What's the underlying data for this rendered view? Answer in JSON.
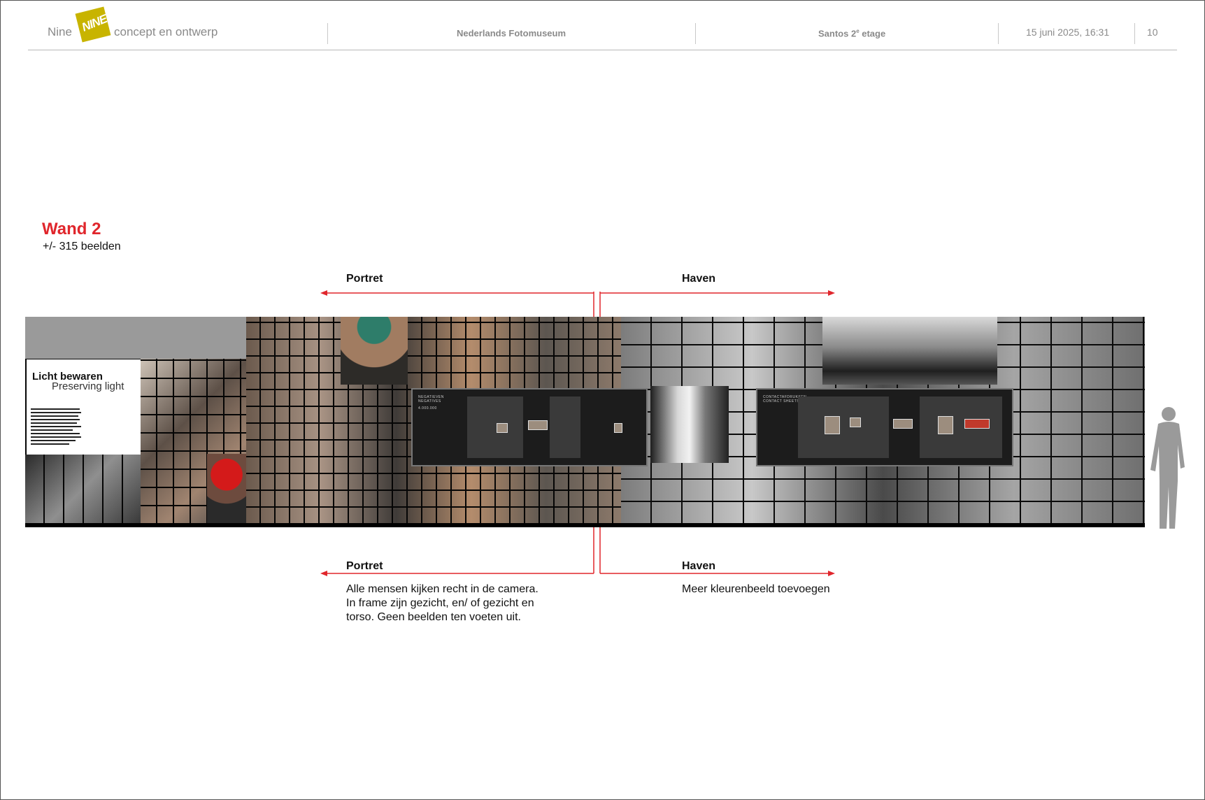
{
  "header": {
    "logo_left": "Nine",
    "logo_mark": "NINE",
    "logo_tagline": "concept en ontwerp",
    "client": "Nederlands Fotomuseum",
    "location_main": "Santos 2",
    "location_sup": "e",
    "location_rest": " etage",
    "datetime": "15 juni 2025, 16:31",
    "page_number": "10"
  },
  "wall": {
    "title": "Wand 2",
    "subtitle": "+/- 315 beelden",
    "panel_title_nl": "Licht bewaren",
    "panel_title_en": "Preserving light",
    "screen_left_caption_1": "NEGATIEVEN",
    "screen_left_caption_2": "NEGATIVES",
    "screen_left_count": "4.000.000",
    "screen_right_caption_1": "CONTACTAFDRUKKEN",
    "screen_right_caption_2": "CONTACT SHEETS"
  },
  "arrows_top": {
    "left_label": "Portret",
    "right_label": "Haven"
  },
  "arrows_bottom": {
    "left_label": "Portret",
    "right_label": "Haven",
    "left_note": "Alle mensen kijken recht in de camera.\nIn frame zijn gezicht, en/ of gezicht en\ntorso. Geen beelden ten voeten uit.",
    "right_note": "Meer kleurenbeeld toevoegen"
  },
  "colors": {
    "accent_red": "#e0262c",
    "logo_yellow": "#c8b400",
    "header_grey": "#8a8a8a"
  }
}
